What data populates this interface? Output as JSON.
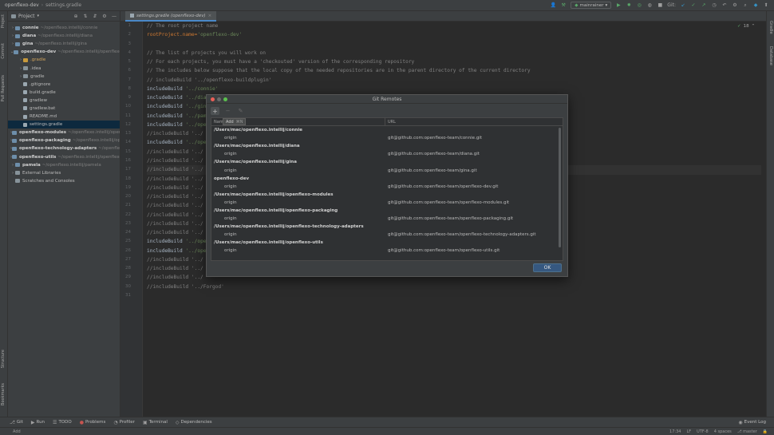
{
  "titlebar": {
    "project": "openflexo-dev",
    "file": "settings.gradle",
    "branch": "mainrainer",
    "git_label": "Git:"
  },
  "left_strip": {
    "tabs": [
      "Project",
      "Commit",
      "Pull Requests",
      "Structure",
      "Bookmarks"
    ]
  },
  "right_strip": {
    "tabs": [
      "Gradle",
      "Database"
    ]
  },
  "project_panel": {
    "title": "Project",
    "tree": [
      {
        "indent": 0,
        "arrow": "›",
        "icon": "module",
        "name": "connie",
        "path": "~/openflexo.intellij/connie",
        "bold": true
      },
      {
        "indent": 0,
        "arrow": "›",
        "icon": "module",
        "name": "diana",
        "path": "~/openflexo.intellij/diana",
        "bold": true
      },
      {
        "indent": 0,
        "arrow": "›",
        "icon": "module",
        "name": "gina",
        "path": "~/openflexo.intellij/gina",
        "bold": true
      },
      {
        "indent": 0,
        "arrow": "⌄",
        "icon": "module",
        "name": "openflexo-dev",
        "path": "~/openflexo.intellij/openflexo-dev",
        "bold": true
      },
      {
        "indent": 1,
        "arrow": "›",
        "icon": "orange",
        "name": ".gradle",
        "path": "",
        "bold": false,
        "orange": true
      },
      {
        "indent": 1,
        "arrow": "›",
        "icon": "folder",
        "name": ".idea",
        "path": "",
        "bold": false
      },
      {
        "indent": 1,
        "arrow": "›",
        "icon": "folder",
        "name": "gradle",
        "path": "",
        "bold": false
      },
      {
        "indent": 1,
        "arrow": "",
        "icon": "file",
        "name": ".gitignore",
        "path": "",
        "bold": false
      },
      {
        "indent": 1,
        "arrow": "",
        "icon": "file",
        "name": "build.gradle",
        "path": "",
        "bold": false
      },
      {
        "indent": 1,
        "arrow": "",
        "icon": "file",
        "name": "gradlew",
        "path": "",
        "bold": false
      },
      {
        "indent": 1,
        "arrow": "",
        "icon": "file",
        "name": "gradlew.bat",
        "path": "",
        "bold": false
      },
      {
        "indent": 1,
        "arrow": "",
        "icon": "file",
        "name": "README.md",
        "path": "",
        "bold": false
      },
      {
        "indent": 1,
        "arrow": "",
        "icon": "file",
        "name": "settings.gradle",
        "path": "",
        "bold": false,
        "selected": true
      },
      {
        "indent": 0,
        "arrow": "›",
        "icon": "module",
        "name": "openflexo-modules",
        "path": "~/openflexo.intellij/openflexo-modules",
        "bold": true
      },
      {
        "indent": 0,
        "arrow": "›",
        "icon": "module",
        "name": "openflexo-packaging",
        "path": "~/openflexo.intellij/openflexo-packaging",
        "bold": true
      },
      {
        "indent": 0,
        "arrow": "›",
        "icon": "module",
        "name": "openflexo-technology-adapters",
        "path": "~/openflexo.intellij/openflexo-technology-adapters",
        "bold": true
      },
      {
        "indent": 0,
        "arrow": "›",
        "icon": "module",
        "name": "openflexo-utils",
        "path": "~/openflexo.intellij/openflexo-utils",
        "bold": true
      },
      {
        "indent": 0,
        "arrow": "›",
        "icon": "module",
        "name": "pamela",
        "path": "~/openflexo.intellij/pamela",
        "bold": true
      },
      {
        "indent": 0,
        "arrow": "›",
        "icon": "folder",
        "name": "External Libraries",
        "path": "",
        "bold": false
      },
      {
        "indent": 0,
        "arrow": "",
        "icon": "folder",
        "name": "Scratches and Consoles",
        "path": "",
        "bold": false
      }
    ]
  },
  "editor": {
    "tab_label": "settings.gradle (openflexo-dev)",
    "badge_count": "18",
    "current_line": 17,
    "lines": [
      [
        {
          "t": "// The root project name",
          "c": "cm"
        }
      ],
      [
        {
          "t": "rootProject.name=",
          "c": "kw"
        },
        {
          "t": "'openflexo-dev'",
          "c": "str"
        }
      ],
      [],
      [
        {
          "t": "// The list of projects you will work on",
          "c": "cm"
        }
      ],
      [
        {
          "t": "// For each projects, you must have a 'checkouted' version of the corresponding repository",
          "c": "cm"
        }
      ],
      [
        {
          "t": "// The includes below suppose that the local copy of the needed repositories are in the parent directory of the current directory",
          "c": "cm"
        }
      ],
      [
        {
          "t": "// includeBuild '../openflexo-buildplugin'",
          "c": "cm"
        }
      ],
      [
        {
          "t": "includeBuild ",
          "c": ""
        },
        {
          "t": "'../connie'",
          "c": "str"
        }
      ],
      [
        {
          "t": "includeBuild ",
          "c": ""
        },
        {
          "t": "'../diana'",
          "c": "str"
        }
      ],
      [
        {
          "t": "includeBuild ",
          "c": ""
        },
        {
          "t": "'../gina'",
          "c": "str"
        }
      ],
      [
        {
          "t": "includeBuild ",
          "c": ""
        },
        {
          "t": "'../pamela'",
          "c": "str"
        }
      ],
      [
        {
          "t": "includeBuild ",
          "c": ""
        },
        {
          "t": "'../openflexo-utils'",
          "c": "str"
        }
      ],
      [
        {
          "t": "//includeBuild '../",
          "c": "cm"
        }
      ],
      [
        {
          "t": "includeBuild ",
          "c": ""
        },
        {
          "t": "'../openflexo-technology-adapters'",
          "c": "str"
        }
      ],
      [
        {
          "t": "//includeBuild '../",
          "c": "cm"
        }
      ],
      [
        {
          "t": "//includeBuild '../",
          "c": "cm"
        }
      ],
      [
        {
          "t": "//includeBuild '../",
          "c": "cm"
        }
      ],
      [
        {
          "t": "//includeBuild '../",
          "c": "cm"
        }
      ],
      [
        {
          "t": "//includeBuild '../",
          "c": "cm"
        }
      ],
      [
        {
          "t": "//includeBuild '../",
          "c": "cm"
        }
      ],
      [
        {
          "t": "//includeBuild '../",
          "c": "cm"
        }
      ],
      [
        {
          "t": "//includeBuild '../",
          "c": "cm"
        }
      ],
      [
        {
          "t": "//includeBuild '../",
          "c": "cm"
        }
      ],
      [
        {
          "t": "//includeBuild '../",
          "c": "cm"
        }
      ],
      [
        {
          "t": "includeBuild ",
          "c": ""
        },
        {
          "t": "'../openflexo-modules'",
          "c": "str"
        }
      ],
      [
        {
          "t": "includeBuild ",
          "c": ""
        },
        {
          "t": "'../openflexo-packaging'",
          "c": "str"
        }
      ],
      [
        {
          "t": "//includeBuild '../",
          "c": "cm"
        }
      ],
      [
        {
          "t": "//includeBuild '../",
          "c": "cm"
        }
      ],
      [
        {
          "t": "//includeBuild '../",
          "c": "cm"
        }
      ],
      [
        {
          "t": "//includeBuild '../Forgod'",
          "c": "cm"
        }
      ],
      []
    ]
  },
  "dialog": {
    "title": "Git Remotes",
    "tooltip_label": "Add",
    "tooltip_shortcut": "⌘N",
    "col_name": "Name",
    "col_url": "URL",
    "ok_label": "OK",
    "groups": [
      {
        "root": "/Users/mac/openflexo.intellij/connie",
        "remote": "origin",
        "url": "git@github.com:openflexo-team/connie.git"
      },
      {
        "root": "/Users/mac/openflexo.intellij/diana",
        "remote": "origin",
        "url": "git@github.com:openflexo-team/diana.git"
      },
      {
        "root": "/Users/mac/openflexo.intellij/gina",
        "remote": "origin",
        "url": "git@github.com:openflexo-team/gina.git"
      },
      {
        "root": "openflexo-dev",
        "remote": "origin",
        "url": "git@github.com:openflexo-team/openflexo-dev.git"
      },
      {
        "root": "/Users/mac/openflexo.intellij/openflexo-modules",
        "remote": "origin",
        "url": "git@github.com:openflexo-team/openflexo-modules.git"
      },
      {
        "root": "/Users/mac/openflexo.intellij/openflexo-packaging",
        "remote": "origin",
        "url": "git@github.com:openflexo-team/openflexo-packaging.git"
      },
      {
        "root": "/Users/mac/openflexo.intellij/openflexo-technology-adapters",
        "remote": "origin",
        "url": "git@github.com:openflexo-team/openflexo-technology-adapters.git"
      },
      {
        "root": "/Users/mac/openflexo.intellij/openflexo-utils",
        "remote": "origin",
        "url": "git@github.com:openflexo-team/openflexo-utils.git"
      }
    ]
  },
  "bottom_tools": [
    {
      "icon": "⎇",
      "label": "Git"
    },
    {
      "icon": "▶",
      "label": "Run"
    },
    {
      "icon": "☰",
      "label": "TODO"
    },
    {
      "icon": "●",
      "label": "Problems"
    },
    {
      "icon": "◔",
      "label": "Profiler"
    },
    {
      "icon": "▣",
      "label": "Terminal"
    },
    {
      "icon": "◇",
      "label": "Dependencies"
    }
  ],
  "event_log_label": "Event Log",
  "statusbar": {
    "message": "Add",
    "position": "17:34",
    "line_sep": "LF",
    "encoding": "UTF-8",
    "indent": "4 spaces",
    "branch": "master"
  }
}
